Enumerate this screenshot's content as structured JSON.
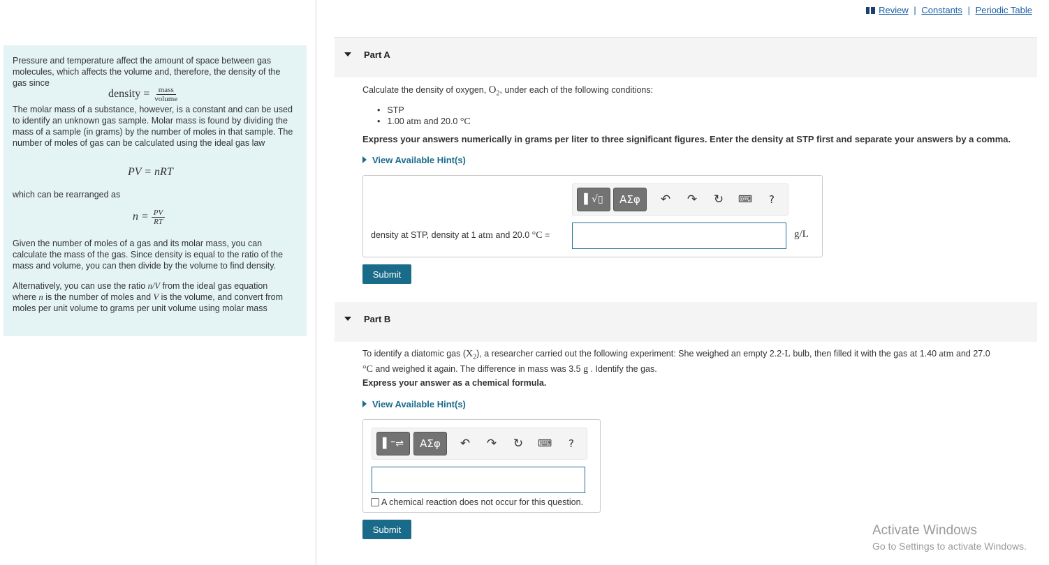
{
  "top_links": {
    "review": "Review",
    "constants": "Constants",
    "periodic_table": "Periodic Table",
    "separator": "|"
  },
  "intro": {
    "p1": "Pressure and temperature affect the amount of space between gas molecules, which affects the volume and, therefore, the density of the gas since",
    "density_eq": {
      "lhs": "density =",
      "num": "mass",
      "den": "volume"
    },
    "p2": "The molar mass of a substance, however, is a constant and can be used to identify an unknown gas sample. Molar mass is found by dividing the mass of a sample (in grams) by the number of moles in that sample. The number of moles of gas can be calculated using the ideal gas law",
    "ideal_gas_eq": "PV = nRT",
    "p3": "which can be rearranged as",
    "n_eq": {
      "lhs": "n =",
      "num": "PV",
      "den": "RT"
    },
    "p4": "Given the number of moles of a gas and its molar mass, you can calculate the mass of the gas. Since density is equal to the ratio of the mass and volume, you can then divide by the volume to find density.",
    "p5_a": "Alternatively, you can use the ratio ",
    "p5_ratio": "n/V",
    "p5_b": " from the ideal gas equation where ",
    "p5_n": "n",
    "p5_c": " is the number of moles and ",
    "p5_v": "V",
    "p5_d": " is the volume, and convert from moles per unit volume to grams per unit volume using molar mass"
  },
  "part_a": {
    "title": "Part A",
    "question_pre": "Calculate the density of oxygen, ",
    "formula": "O",
    "formula_sub": "2",
    "question_post": ", under each of the following conditions:",
    "conditions": [
      "STP",
      "1.00 atm and 20.0 °C"
    ],
    "cond2_num": "1.00 ",
    "cond2_unit": "atm",
    "cond2_mid": " and 20.0 ",
    "cond2_deg": "°C",
    "instruction": "Express your answers numerically in grams per liter to three significant figures. Enter the density at STP first and separate your answers by a comma.",
    "hint": "View Available Hint(s)",
    "label_pre": "density at STP, density at 1 ",
    "label_atm": "atm",
    "label_mid": " and 20.0 ",
    "label_deg": "°C",
    "label_eq": " =",
    "input_value": "",
    "unit": "g/L",
    "submit": "Submit",
    "toolbar": {
      "templates": "▌√▯",
      "symbols": "ΑΣφ",
      "help": "?"
    }
  },
  "part_b": {
    "title": "Part B",
    "q_pre": "To identify a diatomic gas (",
    "q_x": "X",
    "q_sub": "2",
    "q_mid1": "), a researcher carried out the following experiment: She weighed an empty 2.2-",
    "q_L": "L",
    "q_mid2": " bulb, then filled it with the gas at 1.40 ",
    "q_atm": "atm",
    "q_mid3": " and 27.0",
    "q_deg": "°C",
    "q_mid4": " and weighed it again. The difference in mass was 3.5 ",
    "q_g": "g",
    "q_end": " . Identify the gas.",
    "instruction": "Express your answer as a chemical formula.",
    "hint": "View Available Hint(s)",
    "input_value": "",
    "checkbox_label": "A chemical reaction does not occur for this question.",
    "submit": "Submit",
    "toolbar": {
      "templates": "▌⁼⇌",
      "symbols": "ΑΣφ",
      "help": "?"
    }
  },
  "watermark": {
    "line1": "Activate Windows",
    "line2": "Go to Settings to activate Windows."
  }
}
